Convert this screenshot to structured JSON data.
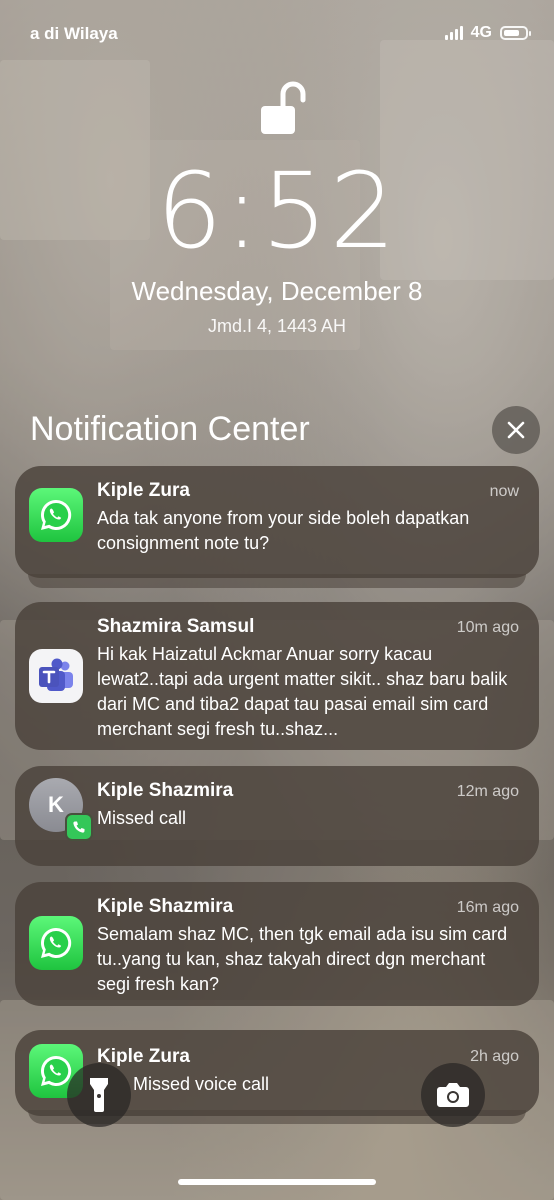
{
  "status_bar": {
    "carrier": "a di Wilaya",
    "network": "4G",
    "signal_bars": 4,
    "battery_level": 0.75
  },
  "lock_screen": {
    "lock_icon": "unlocked-padlock-icon",
    "time": "6:52",
    "date": "Wednesday, December 8",
    "hijri_date": "Jmd.I 4, 1443 AH"
  },
  "notification_center": {
    "title": "Notification Center",
    "close_icon": "close-icon"
  },
  "notifications": [
    {
      "app_icon": "whatsapp-icon",
      "sender": "Kiple Zura",
      "time": "now",
      "message": "Ada tak anyone from your side boleh dapatkan consignment note tu?"
    },
    {
      "app_icon": "microsoft-teams-icon",
      "sender": "Shazmira Samsul",
      "time": "10m ago",
      "message": "Hi kak Haizatul Ackmar Anuar sorry kacau lewat2..tapi ada urgent matter sikit.. shaz baru balik dari MC and tiba2 dapat tau pasai email sim card merchant segi fresh tu..shaz..."
    },
    {
      "app_icon": "contact-avatar",
      "avatar_initial": "K",
      "badge_icon": "phone-icon",
      "sender": "Kiple Shazmira",
      "time": "12m ago",
      "message": "Missed call"
    },
    {
      "app_icon": "whatsapp-icon",
      "sender": "Kiple Shazmira",
      "time": "16m ago",
      "message": "Semalam shaz MC, then tgk email ada isu sim card tu..yang tu kan, shaz takyah direct dgn merchant segi fresh kan?"
    },
    {
      "app_icon": "whatsapp-icon",
      "sender": "Kiple Zura",
      "time": "2h ago",
      "message": "Missed voice call"
    }
  ],
  "quick_actions": {
    "left_icon": "flashlight-icon",
    "right_icon": "camera-icon"
  },
  "colors": {
    "notification_bg": "#4a423a",
    "whatsapp_green": "#25d366",
    "teams_purple": "#5059c9",
    "phone_green": "#34c759"
  }
}
